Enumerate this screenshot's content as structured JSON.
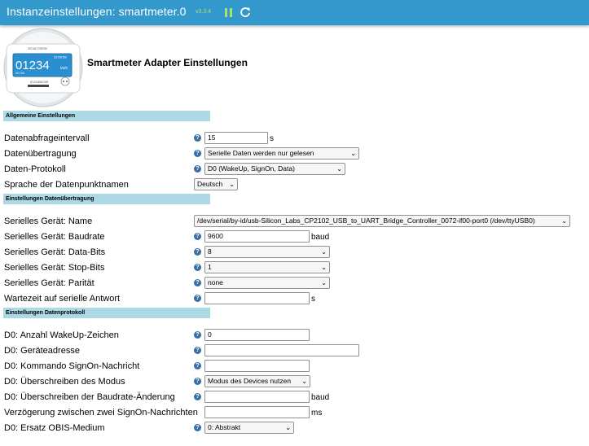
{
  "header": {
    "title": "Instanzeinstellungen: smartmeter.0",
    "version": "v3.3.4"
  },
  "logo": {
    "brand": "Smart Meter",
    "reading": "01234",
    "unit": "kWh",
    "time": "23:59:58",
    "small_number": "56789",
    "serial": "0123456789"
  },
  "page_heading": "Smartmeter Adapter Einstellungen",
  "sections": {
    "general": "Allgemeine Einstellungen",
    "transfer": "Einstellungen Datenübertragung",
    "protocol": "Einstellungen Datenprotokoll"
  },
  "general": {
    "interval_label": "Datenabfrageintervall",
    "interval_value": "15",
    "interval_unit": "s",
    "transfer_label": "Datenübertragung",
    "transfer_value": "Serielle Daten werden nur gelesen",
    "protocol_label": "Daten-Protokoll",
    "protocol_value": "D0 (WakeUp, SignOn, Data)",
    "language_label": "Sprache der Datenpunktnamen",
    "language_value": "Deutsch"
  },
  "transfer": {
    "device_label": "Serielles Gerät: Name",
    "device_value": "/dev/serial/by-id/usb-Silicon_Labs_CP2102_USB_to_UART_Bridge_Controller_0072-if00-port0 (/dev/ttyUSB0)",
    "baud_label": "Serielles Gerät: Baudrate",
    "baud_value": "9600",
    "baud_unit": "baud",
    "databits_label": "Serielles Gerät: Data-Bits",
    "databits_value": "8",
    "stopbits_label": "Serielles Gerät: Stop-Bits",
    "stopbits_value": "1",
    "parity_label": "Serielles Gerät: Parität",
    "parity_value": "none",
    "wait_label": "Wartezeit auf serielle Antwort",
    "wait_value": "",
    "wait_unit": "s"
  },
  "protocol": {
    "wakeup_label": "D0: Anzahl WakeUp-Zeichen",
    "wakeup_value": "0",
    "address_label": "D0: Geräteadresse",
    "address_value": "",
    "signon_label": "D0: Kommando SignOn-Nachricht",
    "signon_value": "",
    "mode_label": "D0: Überschreiben des Modus",
    "mode_value": "Modus des Devices nutzen",
    "baudchange_label": "D0: Überschreiben der Baudrate-Änderung",
    "baudchange_value": "",
    "baudchange_unit": "baud",
    "delay_label": "Verzögerung zwischen zwei SignOn-Nachrichten",
    "delay_value": "",
    "delay_unit": "ms",
    "obis_label": "D0: Ersatz OBIS-Medium",
    "obis_value": "0: Abstrakt"
  },
  "help_glyph": "?",
  "colors": {
    "topbar": "#3399cc",
    "section_bg": "#add8e6",
    "help_icon": "#3a6ea5",
    "version_text": "#a8e36a"
  }
}
